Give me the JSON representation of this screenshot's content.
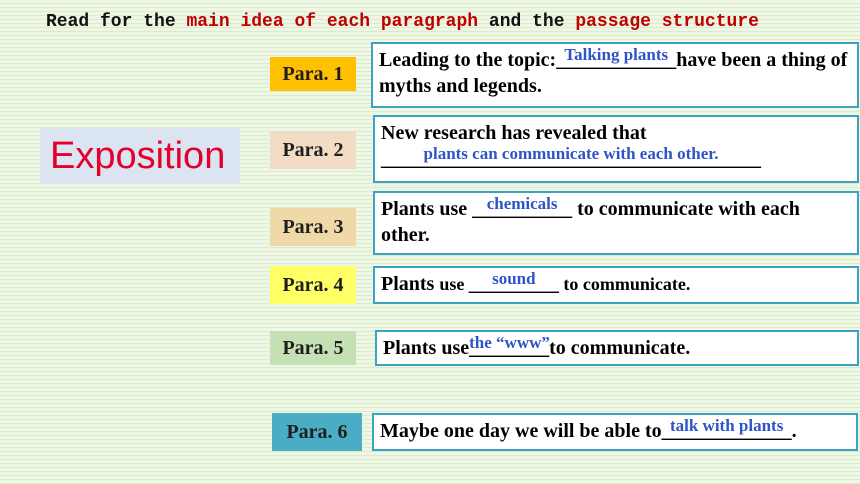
{
  "heading": {
    "p1": "Read for the ",
    "hl1": "main idea of each paragraph",
    "p2": " and the ",
    "hl2": "passage structure"
  },
  "exposition": "Exposition",
  "rows": [
    {
      "para": "Para. 1",
      "lead": "Leading to the topic:",
      "blank": "____________",
      "fill": "Talking plants",
      "rest": "have been a thing of myths and legends."
    },
    {
      "para": "Para. 2",
      "lead": "New research has revealed that",
      "blank": "______________________________________",
      "fill": "plants can communicate with each other."
    },
    {
      "para": "Para. 3",
      "lead": "Plants use ",
      "blank": "__________",
      "fill": "chemicals",
      "rest": " to communicate with each other."
    },
    {
      "para": "Para. 4",
      "lead": "Plants ",
      "lead_small": "use ",
      "blank": "_________",
      "fill": "sound",
      "rest": " to communicate."
    },
    {
      "para": "Para. 5",
      "lead": "Plants use",
      "blank": "________",
      "fill": "the “www”",
      "rest": "to communicate."
    },
    {
      "para": "Para. 6",
      "lead": "Maybe one day we will be able to",
      "blank": "_____________",
      "fill": "talk with plants",
      "rest": "."
    }
  ],
  "colors": {
    "para1": "#ffc000",
    "para2": "#f3dcc5",
    "para3": "#f0d9a8",
    "para4": "#ffff66",
    "para5": "#c5e0b4",
    "para6": "#4bacc6",
    "box_border": "#3aa3c3",
    "fill_text": "#2e54c8",
    "highlight": "#c00000",
    "exposition_text": "#e4002b",
    "exposition_bg": "#dbe5f1"
  }
}
